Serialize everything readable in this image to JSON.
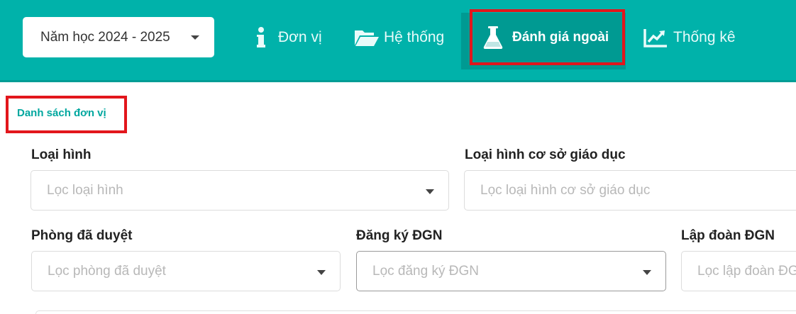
{
  "header": {
    "year_select": "Năm học 2024 - 2025",
    "nav": [
      {
        "label": "Đơn vị",
        "icon": "info-icon"
      },
      {
        "label": "Hệ thống",
        "icon": "folder-open-icon"
      },
      {
        "label": "Đánh giá ngoài",
        "icon": "flask-icon",
        "active": true
      },
      {
        "label": "Thống kê",
        "icon": "chart-line-icon"
      }
    ]
  },
  "breadcrumb": "Danh sách đơn vị",
  "filters": {
    "loai_hinh": {
      "label": "Loại hình",
      "placeholder": "Lọc loại hình"
    },
    "loai_hinh_co_so": {
      "label": "Loại hình cơ sở giáo dục",
      "placeholder": "Lọc loại hình cơ sở giáo dục"
    },
    "phong_da_duyet": {
      "label": "Phòng đã duyệt",
      "placeholder": "Lọc phòng đã duyệt"
    },
    "dang_ky_dgn": {
      "label": "Đăng ký ĐGN",
      "placeholder": "Lọc đăng ký ĐGN"
    },
    "lap_doan_dgn": {
      "label": "Lập đoàn ĐGN",
      "placeholder": "Lọc lập đoàn ĐGN"
    }
  },
  "colors": {
    "brand": "#00b2aa",
    "active_tab": "#009a92",
    "highlight": "#e2161c",
    "link": "#00a79f"
  }
}
